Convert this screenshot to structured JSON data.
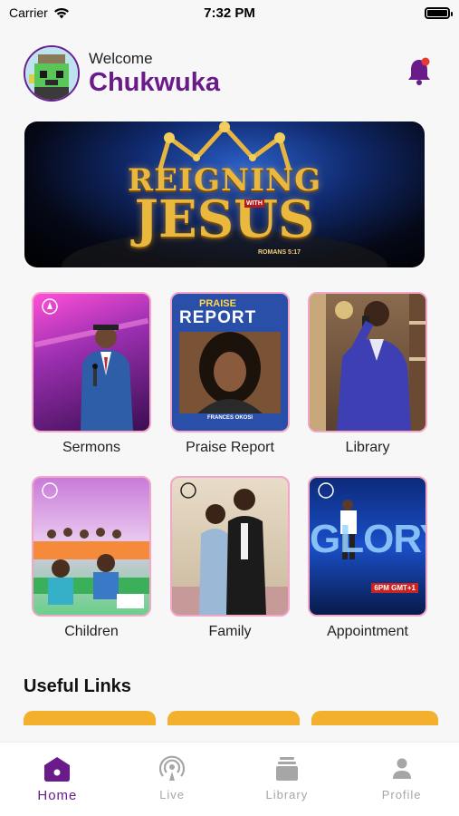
{
  "status_bar": {
    "carrier": "Carrier",
    "time": "7:32 PM"
  },
  "header": {
    "welcome": "Welcome",
    "username": "Chukwuka"
  },
  "banner": {
    "line1": "REIGNING",
    "with": "WITH",
    "line2": "JESUS",
    "reference": "ROMANS 5:17"
  },
  "tiles": [
    {
      "label": "Sermons"
    },
    {
      "label": "Praise Report",
      "image_title": "PRAISE",
      "image_title2": "REPORT",
      "image_caption": "FRANCES OKOSI"
    },
    {
      "label": "Library"
    },
    {
      "label": "Children"
    },
    {
      "label": "Family"
    },
    {
      "label": "Appointment",
      "image_word": "GLORY",
      "image_time": "6PM GMT+1"
    }
  ],
  "useful_links": {
    "title": "Useful Links"
  },
  "tab_bar": {
    "items": [
      {
        "label": "Home",
        "icon": "home-icon"
      },
      {
        "label": "Live",
        "icon": "live-icon"
      },
      {
        "label": "Library",
        "icon": "library-icon"
      },
      {
        "label": "Profile",
        "icon": "profile-icon"
      }
    ]
  },
  "colors": {
    "brand": "#6a1b8a",
    "accent": "#f3b02c",
    "notification": "#e53935"
  }
}
